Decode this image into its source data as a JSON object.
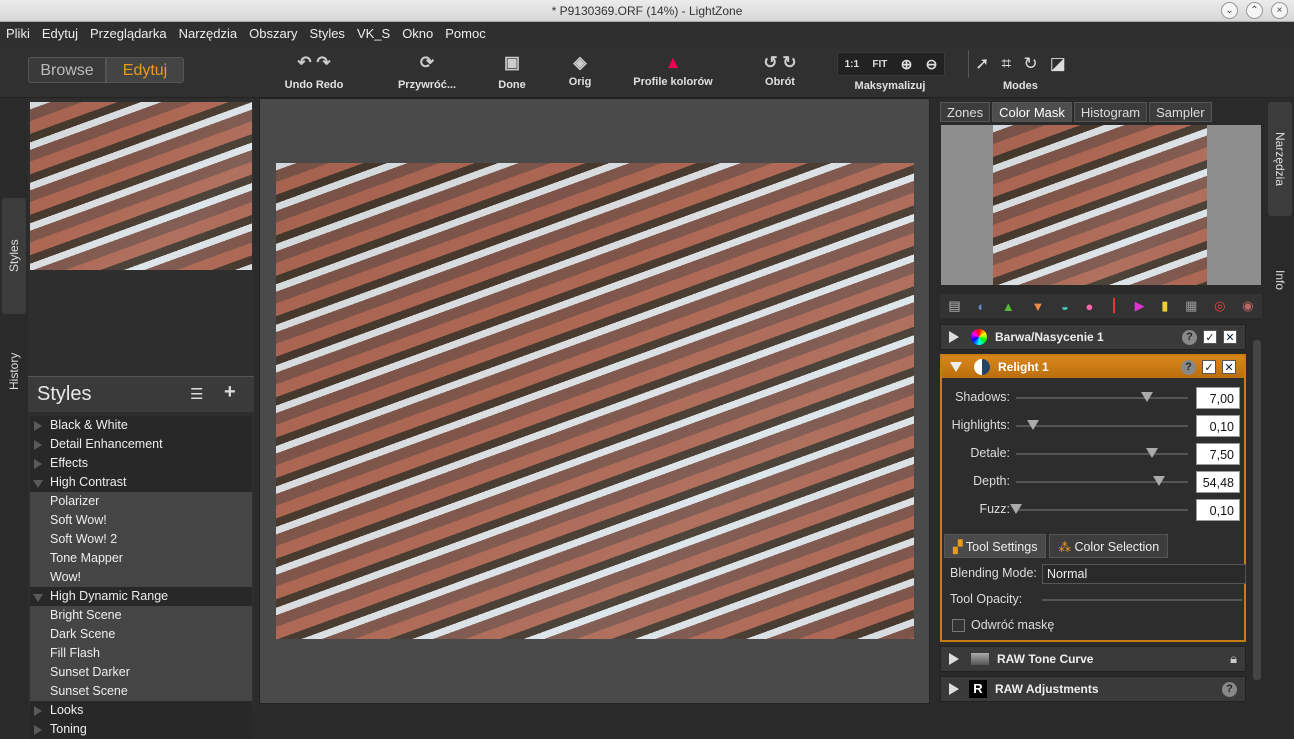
{
  "window": {
    "title": "* P9130369.ORF (14%) - LightZone",
    "btns": [
      "⌄",
      "⌃",
      "×"
    ]
  },
  "menu": [
    "Pliki",
    "Edytuj",
    "Przeglądarka",
    "Narzędzia",
    "Obszary",
    "Styles",
    "VK_S",
    "Okno",
    "Pomoc"
  ],
  "toolbar": {
    "browse": "Browse",
    "edit": "Edytuj",
    "undo_redo": "Undo Redo",
    "revert": "Przywróć...",
    "done": "Done",
    "orig": "Orig",
    "profiles": "Profile kolorów",
    "rotate": "Obrót",
    "maximize": "Maksymalizuj",
    "modes": "Modes",
    "zoom_1to1": "1:1",
    "zoom_fit": "FIT"
  },
  "left_tabs": {
    "styles": "Styles",
    "history": "History"
  },
  "styles_panel": {
    "title": "Styles",
    "items": [
      {
        "label": "Black & White",
        "kind": "cat",
        "open": false
      },
      {
        "label": "Detail Enhancement",
        "kind": "cat",
        "open": false
      },
      {
        "label": "Effects",
        "kind": "cat",
        "open": false
      },
      {
        "label": "High Contrast",
        "kind": "cat",
        "open": true
      },
      {
        "label": "Polarizer",
        "kind": "child"
      },
      {
        "label": "Soft Wow!",
        "kind": "child"
      },
      {
        "label": "Soft Wow! 2",
        "kind": "child"
      },
      {
        "label": "Tone Mapper",
        "kind": "child"
      },
      {
        "label": "Wow!",
        "kind": "child"
      },
      {
        "label": "High Dynamic Range",
        "kind": "cat",
        "open": true
      },
      {
        "label": "Bright Scene",
        "kind": "child"
      },
      {
        "label": "Dark Scene",
        "kind": "child"
      },
      {
        "label": "Fill Flash",
        "kind": "child"
      },
      {
        "label": "Sunset Darker",
        "kind": "child"
      },
      {
        "label": "Sunset Scene",
        "kind": "child"
      },
      {
        "label": "Looks",
        "kind": "cat",
        "open": false
      },
      {
        "label": "Toning",
        "kind": "cat",
        "open": false
      }
    ]
  },
  "right_tabs": [
    "Zones",
    "Color Mask",
    "Histogram",
    "Sampler"
  ],
  "side_tabs_right": {
    "tools": "Narzędzia",
    "info": "Info"
  },
  "tools": {
    "hue_sat": "Barwa/Nasycenie 1",
    "relight": {
      "title": "Relight 1",
      "sliders": [
        {
          "label": "Shadows:",
          "value": "7,00",
          "pos": 0.76
        },
        {
          "label": "Highlights:",
          "value": "0,10",
          "pos": 0.1
        },
        {
          "label": "Detale:",
          "value": "7,50",
          "pos": 0.79
        },
        {
          "label": "Depth:",
          "value": "54,48",
          "pos": 0.83
        },
        {
          "label": "Fuzz:",
          "value": "0,10",
          "pos": 0.0
        }
      ],
      "tab_tool_settings": "Tool Settings",
      "tab_color_selection": "Color Selection",
      "blending_label": "Blending Mode:",
      "blending_value": "Normal",
      "opacity_label": "Tool Opacity:",
      "invert_label": "Odwróć maskę"
    },
    "raw_tone_curve": "RAW Tone Curve",
    "raw_adjustments": "RAW Adjustments"
  },
  "colors": {
    "accent": "#e89a1c",
    "relight_border": "#c87c12"
  }
}
